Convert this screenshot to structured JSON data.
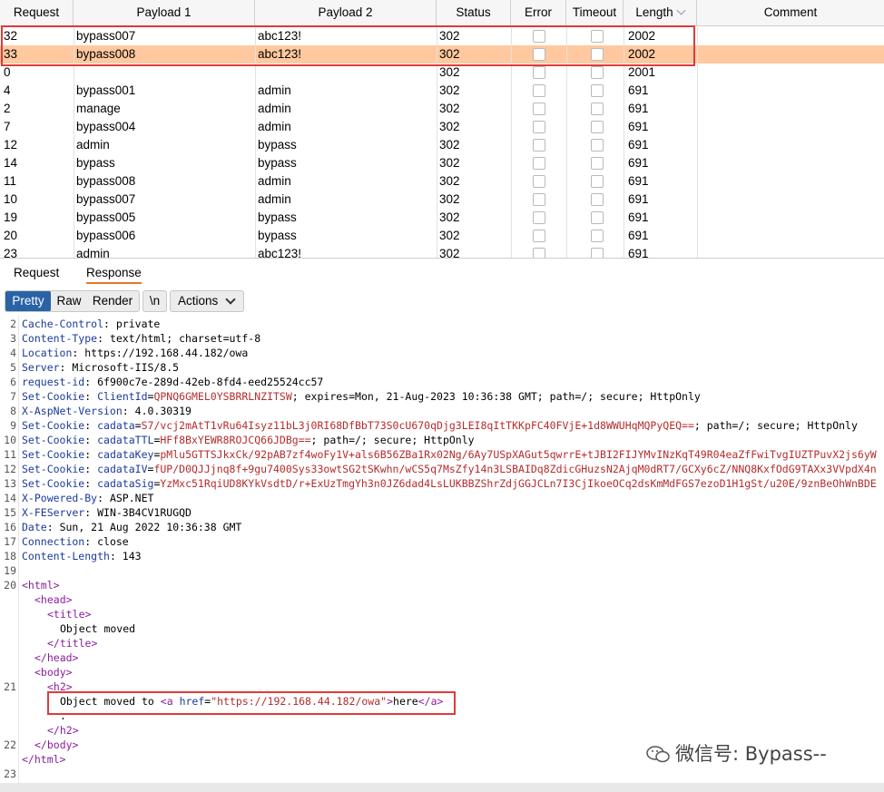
{
  "table": {
    "headers": [
      "Request",
      "Payload 1",
      "Payload 2",
      "Status",
      "Error",
      "Timeout",
      "Length",
      "Comment"
    ],
    "rows": [
      {
        "request": "32",
        "payload1": "bypass007",
        "payload2": "abc123!",
        "status": "302",
        "length": "2002"
      },
      {
        "request": "33",
        "payload1": "bypass008",
        "payload2": "abc123!",
        "status": "302",
        "length": "2002"
      },
      {
        "request": "0",
        "payload1": "",
        "payload2": "",
        "status": "302",
        "length": "2001"
      },
      {
        "request": "4",
        "payload1": "bypass001",
        "payload2": "admin",
        "status": "302",
        "length": "691"
      },
      {
        "request": "2",
        "payload1": "manage",
        "payload2": "admin",
        "status": "302",
        "length": "691"
      },
      {
        "request": "7",
        "payload1": "bypass004",
        "payload2": "admin",
        "status": "302",
        "length": "691"
      },
      {
        "request": "12",
        "payload1": "admin",
        "payload2": "bypass",
        "status": "302",
        "length": "691"
      },
      {
        "request": "14",
        "payload1": "bypass",
        "payload2": "bypass",
        "status": "302",
        "length": "691"
      },
      {
        "request": "11",
        "payload1": "bypass008",
        "payload2": "admin",
        "status": "302",
        "length": "691"
      },
      {
        "request": "10",
        "payload1": "bypass007",
        "payload2": "admin",
        "status": "302",
        "length": "691"
      },
      {
        "request": "19",
        "payload1": "bypass005",
        "payload2": "bypass",
        "status": "302",
        "length": "691"
      },
      {
        "request": "20",
        "payload1": "bypass006",
        "payload2": "bypass",
        "status": "302",
        "length": "691"
      },
      {
        "request": "23",
        "payload1": "admin",
        "payload2": "abc123!",
        "status": "302",
        "length": "691"
      }
    ]
  },
  "tabs": {
    "request": "Request",
    "response": "Response"
  },
  "toolbar": {
    "pretty": "Pretty",
    "raw": "Raw",
    "render": "Render",
    "newline": "\\n",
    "actions": "Actions"
  },
  "response_lines": [
    {
      "n": "2",
      "key": "Cache-Control",
      "val": " private"
    },
    {
      "n": "3",
      "key": "Content-Type",
      "val": " text/html; charset=utf-8"
    },
    {
      "n": "4",
      "key": "Location",
      "val": " https://192.168.44.182/owa"
    },
    {
      "n": "5",
      "key": "Server",
      "val": " Microsoft-IIS/8.5"
    },
    {
      "n": "6",
      "key": "request-id",
      "val": " 6f900c7e-289d-42eb-8fd4-eed25524cc57"
    },
    {
      "n": "7",
      "key": "Set-Cookie",
      "ckey": "ClientId",
      "cval": "QPNQ6GMEL0YSBRRLNZITSW",
      "rest": "; expires=Mon, 21-Aug-2023 10:36:38 GMT; path=/; secure; HttpOnly"
    },
    {
      "n": "8",
      "key": "X-AspNet-Version",
      "val": " 4.0.30319"
    },
    {
      "n": "9",
      "key": "Set-Cookie",
      "ckey": "cadata",
      "cval": "S7/vcj2mAtT1vRu64Isyz11bL3j0RI68DfBbT73S0cU670qDjg3LEI8qItTKKpFC40FVjE+1d8WWUHqMQPyQEQ==",
      "rest": "; path=/; secure; HttpOnly"
    },
    {
      "n": "10",
      "key": "Set-Cookie",
      "ckey": "cadataTTL",
      "cval": "HFf8BxYEWR8ROJCQ66JDBg==",
      "rest": "; path=/; secure; HttpOnly"
    },
    {
      "n": "11",
      "key": "Set-Cookie",
      "ckey": "cadataKey",
      "cval": "pMlu5GTTSJkxCk/92pAB7zf4woFy1V+als6B56ZBa1Rx02Ng/6Ay7USpXAGut5qwrrE+tJBI2FIJYMvINzKqT49R04eaZfFwiTvgIUZTPuvX2js6yW",
      "rest": ""
    },
    {
      "n": "12",
      "key": "Set-Cookie",
      "ckey": "cadataIV",
      "cval": "fUP/D0QJJjnq8f+9gu7400Sys33owtSG2tSKwhn/wCS5q7MsZfy14n3LSBAIDq8ZdicGHuzsN2AjqM0dRT7/GCXy6cZ/NNQ8KxfOdG9TAXx3VVpdX4n",
      "rest": ""
    },
    {
      "n": "13",
      "key": "Set-Cookie",
      "ckey": "cadataSig",
      "cval": "YzMxc51RqiUD8KYkVsdtD/r+ExUzTmgYh3n0JZ6dad4LsLUKBBZShrZdjGGJCLn7I3CjIkoeOCq2dsKmMdFGS7ezoD1H1gSt/u20E/9znBeOhWnBDE",
      "rest": ""
    },
    {
      "n": "14",
      "key": "X-Powered-By",
      "val": " ASP.NET"
    },
    {
      "n": "15",
      "key": "X-FEServer",
      "val": " WIN-3B4CV1RUGQD"
    },
    {
      "n": "16",
      "key": "Date",
      "val": " Sun, 21 Aug 2022 10:36:38 GMT"
    },
    {
      "n": "17",
      "key": "Connection",
      "val": " close"
    },
    {
      "n": "18",
      "key": "Content-Length",
      "val": " 143"
    }
  ],
  "html_lines": {
    "n19": "19",
    "n20": "20",
    "n21": "21",
    "n22": "22",
    "n23": "23",
    "html_open": "<html>",
    "head_open": "<head>",
    "title_open": "<title>",
    "title_text": "Object moved",
    "title_close": "</title>",
    "head_close": "</head>",
    "body_open": "<body>",
    "h2_open": "<h2>",
    "moved_text": "Object moved to ",
    "a_open": "<a ",
    "href_attr": "href",
    "eq": "=",
    "href_val": "\"https://192.168.44.182/owa\"",
    "a_gt": ">",
    "here": "here",
    "a_close": "</a>",
    "dot": ".",
    "h2_close": "</h2>",
    "body_close": "</body>",
    "html_close": "</html>"
  },
  "watermark": "微信号: Bypass--"
}
